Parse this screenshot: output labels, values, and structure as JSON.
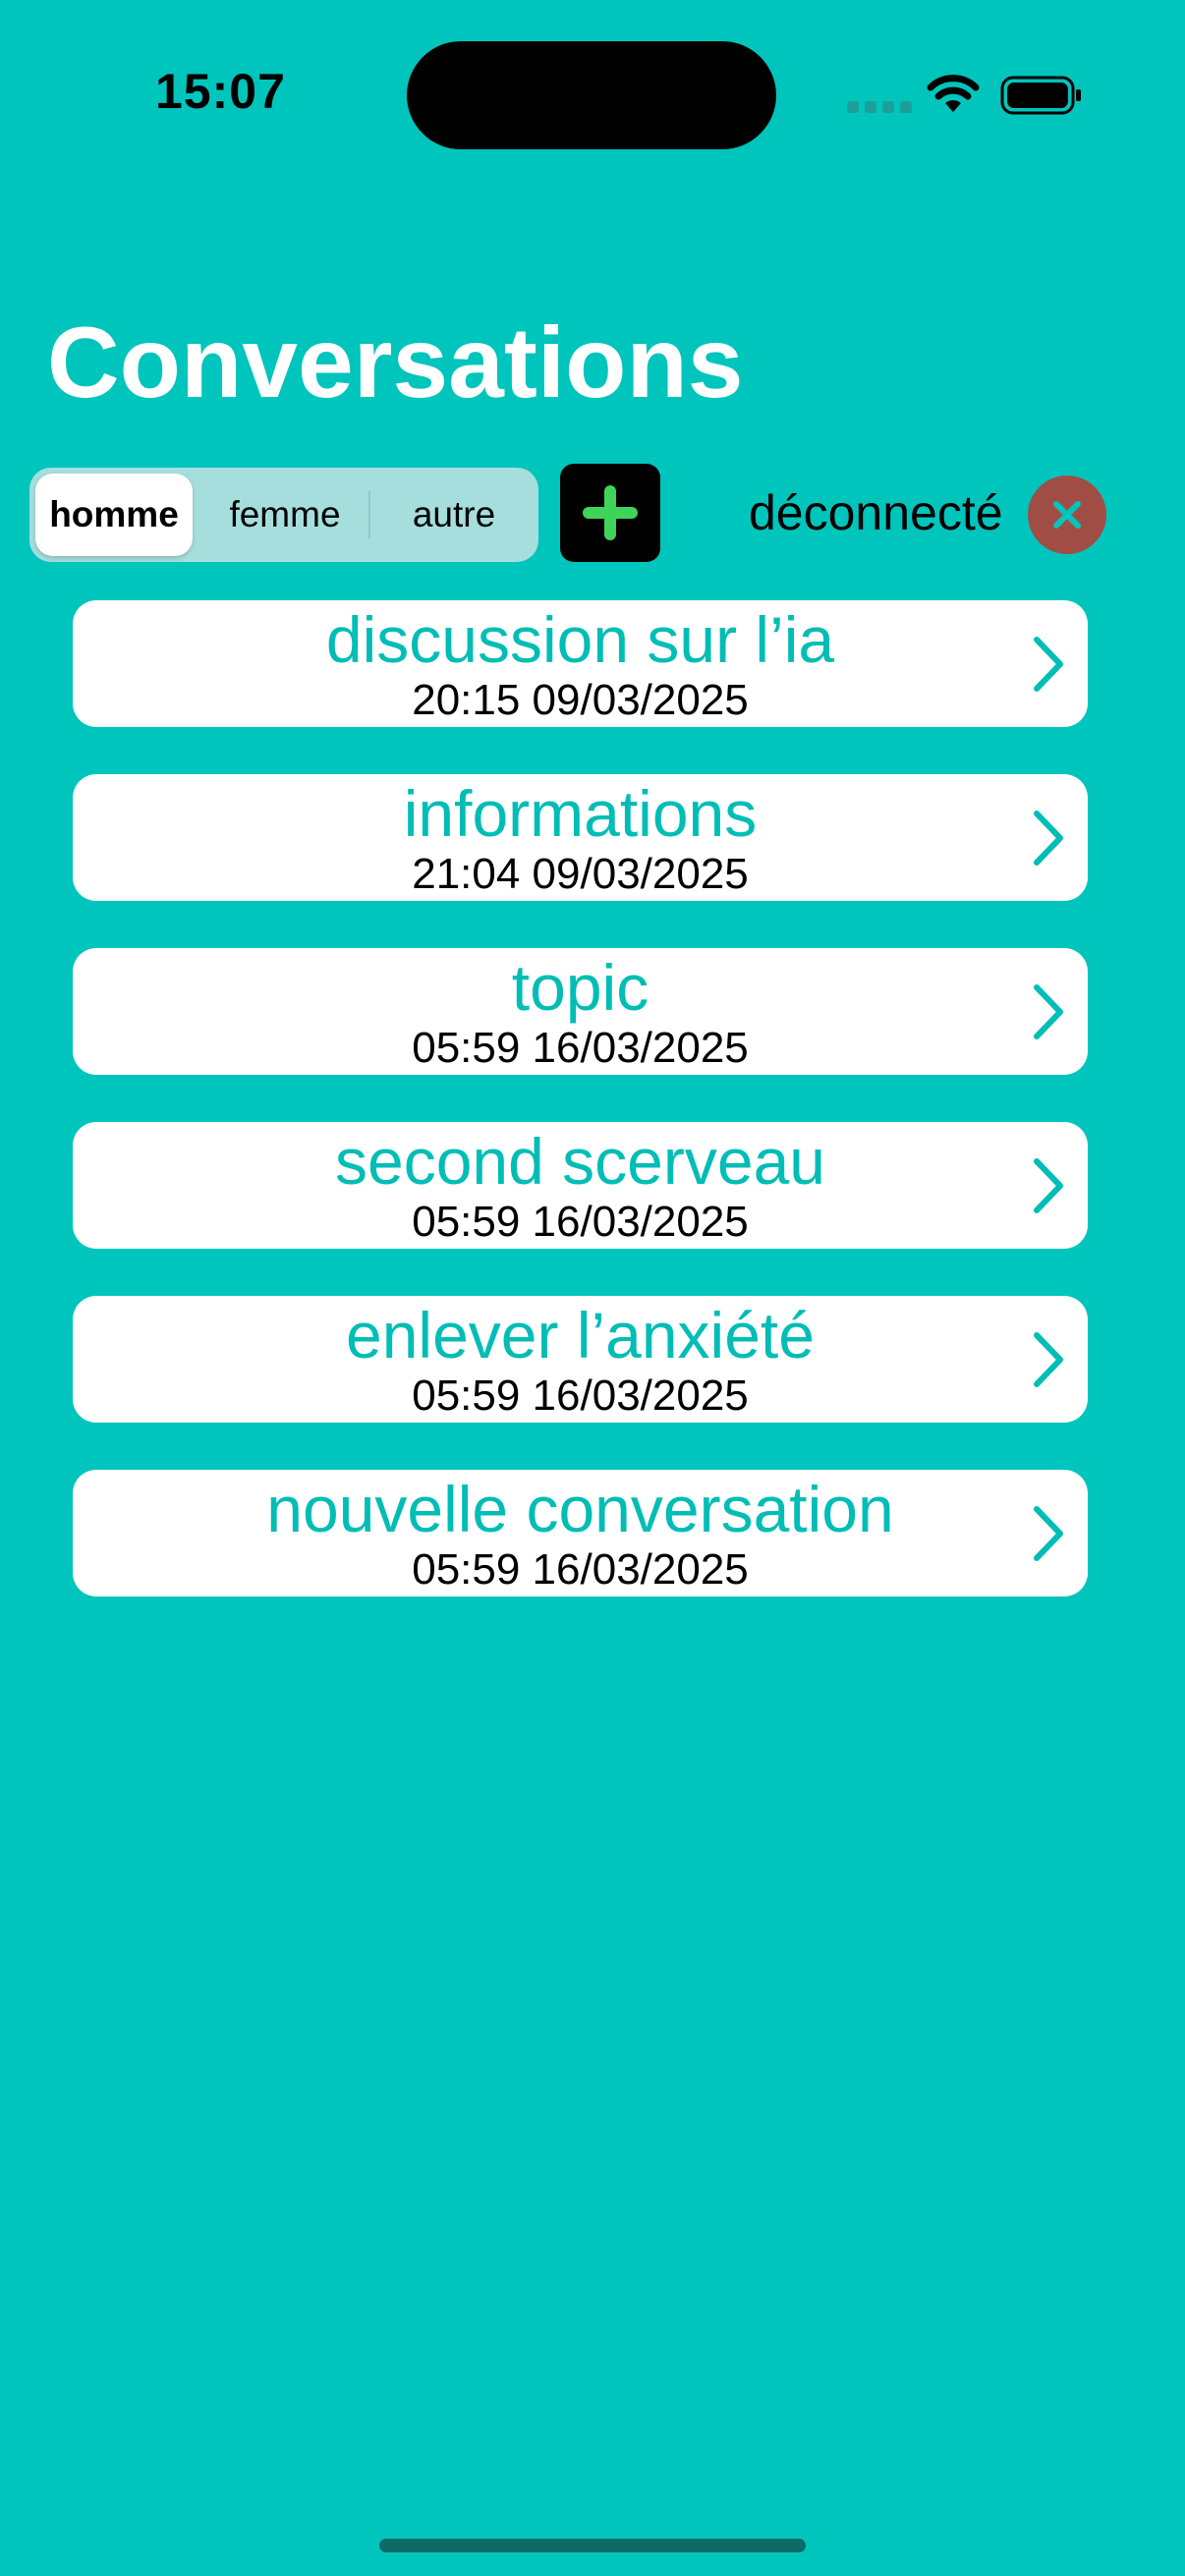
{
  "status_bar": {
    "time": "15:07"
  },
  "header": {
    "title": "Conversations"
  },
  "gender_selector": {
    "options": [
      "homme",
      "femme",
      "autre"
    ],
    "selected": "homme"
  },
  "toolbar": {
    "add_icon": "plus-icon",
    "disconnect_label": "déconnecté",
    "disconnect_icon": "close-icon"
  },
  "conversations": [
    {
      "title": "discussion sur l’ia",
      "date": "20:15 09/03/2025"
    },
    {
      "title": "informations",
      "date": "21:04 09/03/2025"
    },
    {
      "title": "topic",
      "date": "05:59 16/03/2025"
    },
    {
      "title": "second scerveau",
      "date": "05:59 16/03/2025"
    },
    {
      "title": "enlever l’anxiété",
      "date": "05:59 16/03/2025"
    },
    {
      "title": "nouvelle conversation",
      "date": "05:59 16/03/2025"
    }
  ],
  "colors": {
    "background": "#00C5BD",
    "accent_text": "#00BDB6",
    "add_plus": "#3FD35A",
    "close_button": "#A04E45"
  }
}
